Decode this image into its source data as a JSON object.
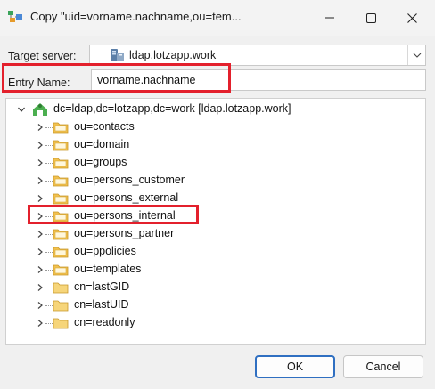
{
  "window": {
    "title": "Copy \"uid=vorname.nachname,ou=tem...",
    "minimize_icon": "minimize-icon",
    "maximize_icon": "maximize-icon",
    "close_icon": "close-icon"
  },
  "form": {
    "target_server_label": "Target server:",
    "target_server_value": "ldap.lotzapp.work",
    "entry_name_label": "Entry Name:",
    "entry_name_value": "vorname.nachname"
  },
  "tree": {
    "root": {
      "label": "dc=ldap,dc=lotzapp,dc=work [ldap.lotzapp.work]",
      "expanded": true
    },
    "items": [
      {
        "label": "ou=contacts",
        "icon": "folder-icon"
      },
      {
        "label": "ou=domain",
        "icon": "folder-icon"
      },
      {
        "label": "ou=groups",
        "icon": "folder-icon"
      },
      {
        "label": "ou=persons_customer",
        "icon": "folder-icon"
      },
      {
        "label": "ou=persons_external",
        "icon": "folder-icon"
      },
      {
        "label": "ou=persons_internal",
        "icon": "folder-icon",
        "highlighted": true
      },
      {
        "label": "ou=persons_partner",
        "icon": "folder-icon"
      },
      {
        "label": "ou=ppolicies",
        "icon": "folder-icon"
      },
      {
        "label": "ou=templates",
        "icon": "folder-icon"
      },
      {
        "label": "cn=lastGID",
        "icon": "object-icon"
      },
      {
        "label": "cn=lastUID",
        "icon": "object-icon"
      },
      {
        "label": "cn=readonly",
        "icon": "object-icon"
      }
    ]
  },
  "buttons": {
    "ok": "OK",
    "cancel": "Cancel"
  },
  "colors": {
    "highlight_box": "#e3202c",
    "default_button_border": "#2f6fc1",
    "folder": "#f2c14e"
  }
}
